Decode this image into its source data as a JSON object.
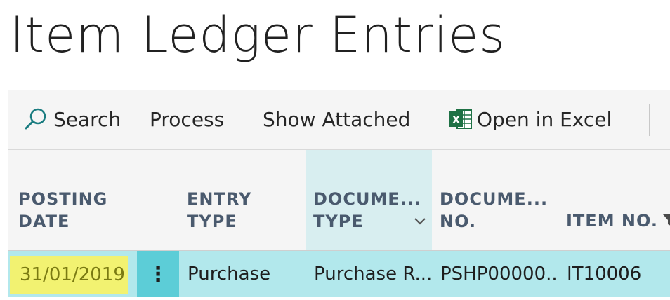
{
  "page": {
    "title": "Item Ledger Entries"
  },
  "actions": {
    "search": "Search",
    "process": "Process",
    "show_attached": "Show Attached",
    "open_in_excel": "Open in Excel"
  },
  "columns": {
    "posting_date": [
      "POSTING",
      "DATE"
    ],
    "entry_type": [
      "ENTRY",
      "TYPE"
    ],
    "document_type": [
      "DOCUME...",
      "TYPE"
    ],
    "document_no": [
      "DOCUME...",
      "NO."
    ],
    "item_no": [
      "",
      "ITEM NO."
    ]
  },
  "row": {
    "posting_date": "31/01/2019",
    "row_menu": "⋮",
    "entry_type": "Purchase",
    "document_type": "Purchase R...",
    "document_no": "PSHP00000...",
    "item_no": "IT10006"
  },
  "colors": {
    "accent_teal": "#5ccdd7",
    "row_selected": "#b2e8ec",
    "date_highlight": "#f2f271",
    "excel_green": "#1e7145"
  }
}
